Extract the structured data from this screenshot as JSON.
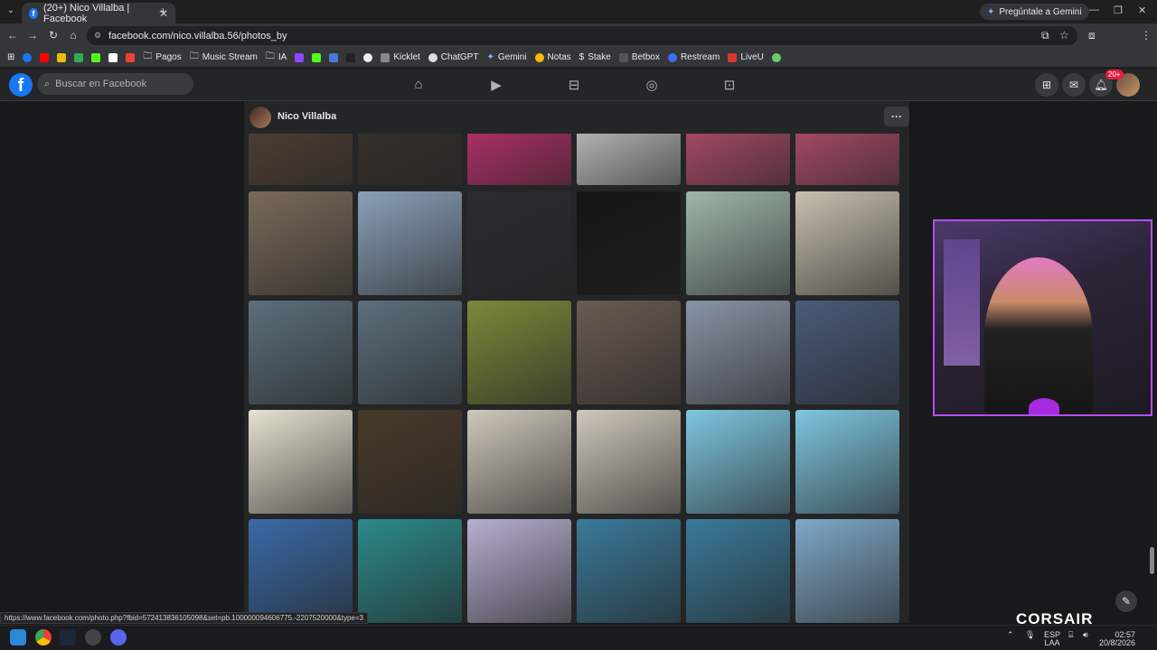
{
  "browser": {
    "tab_title": "(20+) Nico Villalba | Facebook",
    "gemini_button": "Pregúntale a Gemini",
    "url": "facebook.com/nico.villalba.56/photos_by",
    "bookmarks": [
      "Kicklet",
      "ChatGPT",
      "Gemini",
      "Notas",
      "Stake",
      "Betbox",
      "Restream",
      "LiveU"
    ],
    "bookmark_folders": [
      "Pagos",
      "Music Stream",
      "IA"
    ]
  },
  "facebook": {
    "search_placeholder": "Buscar en Facebook",
    "notification_count": "20+",
    "profile_name": "Nico Villalba",
    "more_button": "···"
  },
  "photos": [
    [
      "#5a4638",
      "#3a342c",
      "#d6337a",
      "#e0e0e0",
      "#cc5577",
      "#cc5577"
    ],
    [
      "#7a6a5a",
      "#8aa0b8",
      "#2c2c30",
      "#151515",
      "#9fb7a8",
      "#c8c0b0"
    ],
    [
      "#5c6f7c",
      "#5c6f7c",
      "#7a8a3a",
      "#6a5a52",
      "#8a94a6",
      "#4a5a7a"
    ],
    [
      "#e6e2d0",
      "#4a3a2a",
      "#cfc8bc",
      "#cfc8bc",
      "#7ec6e0",
      "#7ec6e0"
    ],
    [
      "#3a6aa6",
      "#2c8a8a",
      "#b7aed0",
      "#3a7a9a",
      "#3a7a9a",
      "#7fa8c8"
    ]
  ],
  "status_url": "https://www.facebook.com/photo.php?fbid=572413836105098&set=pb.100000094606775.-2207520000&type=3",
  "overlay": {
    "brand": "CORSAIR"
  },
  "taskbar": {
    "lang_top": "ESP",
    "lang_bottom": "LAA",
    "time": "02:57",
    "date": "20/8/2026"
  }
}
